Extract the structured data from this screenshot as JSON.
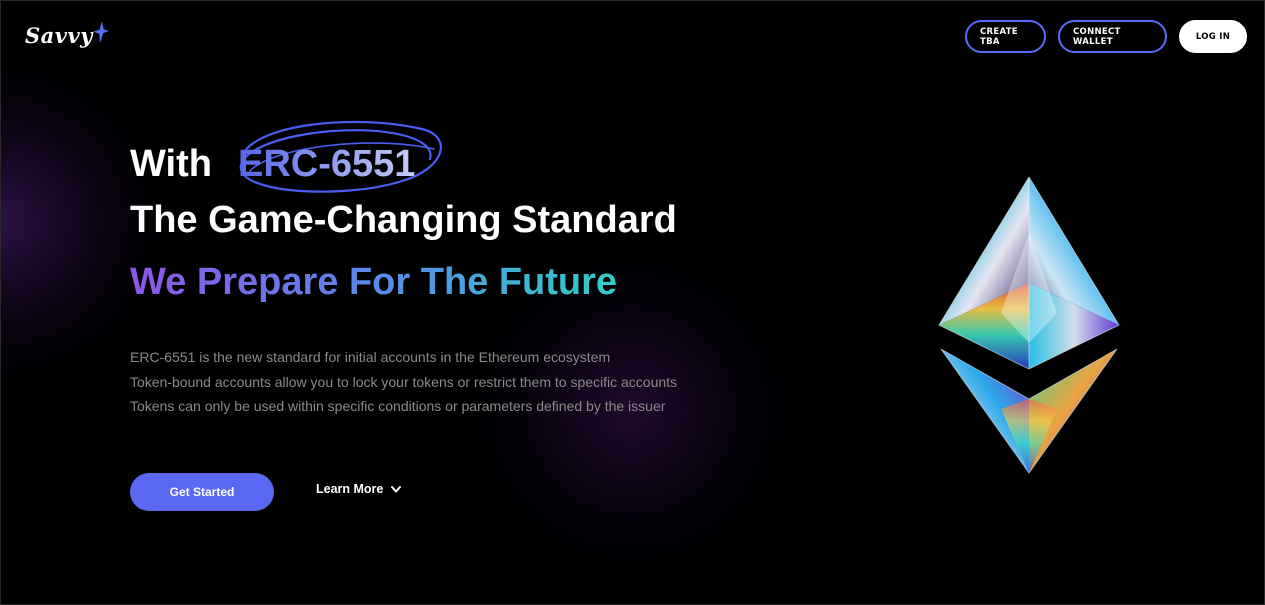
{
  "logo": {
    "text": "Savvy"
  },
  "nav": {
    "create_tba": "CREATE TBA",
    "connect_wallet": "CONNECT WALLET",
    "log_in": "LOG IN"
  },
  "hero": {
    "line1_prefix": "With",
    "line1_highlight": "ERC-6551",
    "line2": "The Game-Changing Standard",
    "line3": "We Prepare For The Future"
  },
  "description": [
    "ERC-6551 is the new standard for initial accounts in the Ethereum ecosystem",
    "Token-bound accounts allow you to lock your tokens or restrict them to specific accounts",
    "Tokens can only be used within specific conditions or parameters defined by the issuer"
  ],
  "actions": {
    "get_started": "Get Started",
    "learn_more": "Learn More"
  },
  "colors": {
    "accent": "#5a69f2",
    "gradient_start": "#8d57e6",
    "gradient_end": "#2fd0c6",
    "background": "#000000"
  }
}
